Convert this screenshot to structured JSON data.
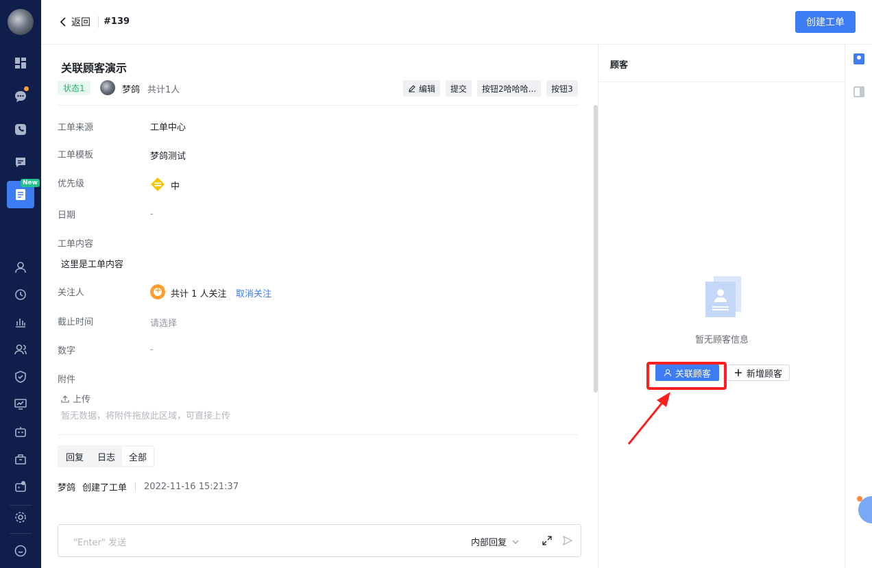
{
  "nav": {
    "new_badge": "New"
  },
  "header": {
    "back_label": "返回",
    "ticket_no": "#139",
    "create_button": "创建工单"
  },
  "ticket": {
    "title": "关联顾客演示",
    "status": "状态1",
    "owner": "梦鸽",
    "owner_count": "共计1人",
    "actions": [
      "编辑",
      "提交",
      "按钮2哈哈哈...",
      "按钮3"
    ]
  },
  "fields": {
    "source": {
      "label": "工单来源",
      "value": "工单中心"
    },
    "template": {
      "label": "工单模板",
      "value": "梦鸽测试"
    },
    "priority": {
      "label": "优先级",
      "value": "中"
    },
    "date": {
      "label": "日期",
      "value": "-"
    },
    "content": {
      "label": "工单内容",
      "value": "这里是工单内容"
    },
    "followers": {
      "label": "关注人",
      "value": "共计 1 人关注",
      "action": "取消关注"
    },
    "deadline": {
      "label": "截止时间",
      "placeholder": "请选择"
    },
    "number": {
      "label": "数字",
      "value": "-"
    },
    "attachment": {
      "label": "附件",
      "upload": "上传",
      "hint": "暂无数据，将附件拖放此区域，可直接上传"
    }
  },
  "tabs": [
    "回复",
    "日志",
    "全部"
  ],
  "active_tab": "全部",
  "log": {
    "user": "梦鸽",
    "action": "创建了工单",
    "time": "2022-11-16 15:21:37"
  },
  "composer": {
    "placeholder": "\"Enter\" 发送",
    "mode": "内部回复"
  },
  "customer_panel": {
    "title": "顾客",
    "empty_text": "暂无顾客信息",
    "associate_button": "关联顾客",
    "add_button": "新增顾客"
  },
  "colors": {
    "nav_bg": "#0f1e4a",
    "accent": "#3d7cf3",
    "highlight": "#ff1f1f",
    "status_green": "#21b46c",
    "priority_yellow": "#f5c400"
  }
}
